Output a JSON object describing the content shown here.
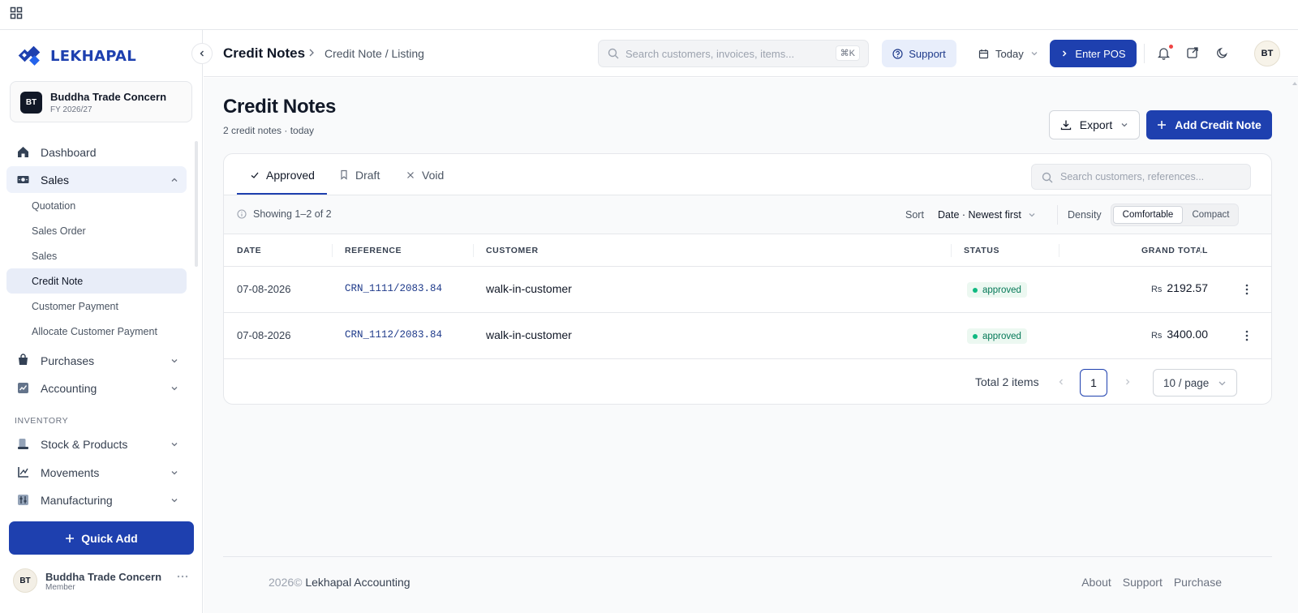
{
  "app": {
    "brand": "LEKHAPAL",
    "colors": {
      "primary": "#1e40af",
      "success": "#10b981",
      "accent_bg": "#eef2fb"
    }
  },
  "org": {
    "initials": "BT",
    "name": "Buddha Trade Concern",
    "fy": "FY 2026/27"
  },
  "sidebar": {
    "items": [
      {
        "label": "Dashboard",
        "icon": "home-icon"
      },
      {
        "label": "Sales",
        "icon": "sales-icon",
        "expanded": true
      },
      {
        "label": "Purchases",
        "icon": "purchases-icon"
      },
      {
        "label": "Accounting",
        "icon": "accounting-icon"
      }
    ],
    "sales_sub": [
      "Quotation",
      "Sales Order",
      "Sales",
      "Credit Note",
      "Customer Payment",
      "Allocate Customer Payment"
    ],
    "inventory_label": "INVENTORY",
    "inventory_items": [
      {
        "label": "Stock & Products",
        "icon": "stock-icon"
      },
      {
        "label": "Movements",
        "icon": "movements-icon"
      },
      {
        "label": "Manufacturing",
        "icon": "manufacturing-icon"
      }
    ],
    "quick_add": "Quick Add"
  },
  "user": {
    "initials": "BT",
    "name": "Buddha Trade Concern",
    "role": "Member"
  },
  "header": {
    "title": "Credit Notes",
    "breadcrumb": "Credit Note / Listing",
    "search_placeholder": "Search customers, invoices, items...",
    "search_kbd": "⌘K",
    "support": "Support",
    "date_filter": "Today",
    "enter_pos": "Enter POS",
    "avatar": "BT"
  },
  "page": {
    "title": "Credit Notes",
    "subtitle": "2 credit notes · today",
    "export": "Export",
    "add": "Add Credit Note"
  },
  "tabs": [
    {
      "label": "Approved",
      "active": true
    },
    {
      "label": "Draft"
    },
    {
      "label": "Void"
    }
  ],
  "table": {
    "search_placeholder": "Search customers, references...",
    "showing": "Showing 1–2 of 2",
    "sort_label": "Sort",
    "sort_value": "Date · Newest first",
    "density_label": "Density",
    "density_options": [
      "Comfortable",
      "Compact"
    ],
    "columns": [
      "DATE",
      "REFERENCE",
      "CUSTOMER",
      "STATUS",
      "GRAND TOTAL"
    ],
    "currency": "Rs",
    "rows": [
      {
        "date": "07-08-2026",
        "reference": "CRN_1111/2083.84",
        "customer": "walk-in-customer",
        "status": "approved",
        "total": "2192.57"
      },
      {
        "date": "07-08-2026",
        "reference": "CRN_1112/2083.84",
        "customer": "walk-in-customer",
        "status": "approved",
        "total": "3400.00"
      }
    ],
    "pagination": {
      "total": "Total 2 items",
      "page": "1",
      "page_size": "10 / page"
    }
  },
  "footer": {
    "year": "2026©",
    "company": "Lekhapal Accounting",
    "links": [
      "About",
      "Support",
      "Purchase"
    ]
  }
}
